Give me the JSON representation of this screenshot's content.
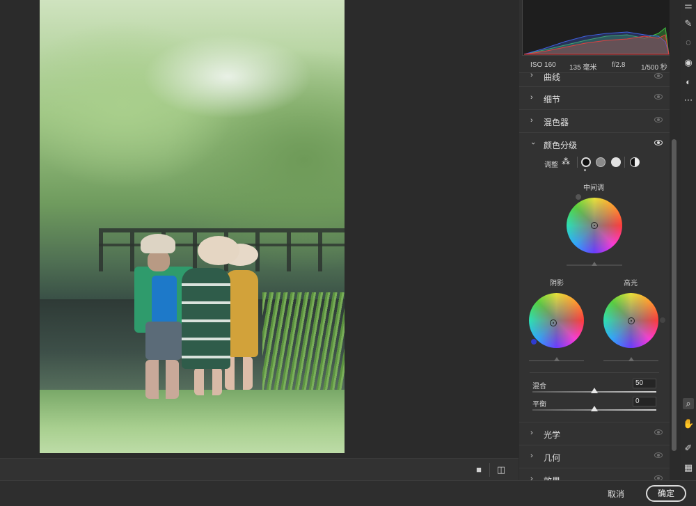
{
  "meta": {
    "iso": "ISO 160",
    "focal": "135 毫米",
    "aperture": "f/2.8",
    "shutter": "1/500 秒"
  },
  "panels": {
    "curves": "曲线",
    "detail": "细节",
    "mixer": "混色器",
    "color_grading": "颜色分级",
    "optics": "光学",
    "geometry": "几何",
    "effects": "效果"
  },
  "grading": {
    "adjust_label": "调整",
    "midtones_label": "中间调",
    "shadows_label": "阴影",
    "highlights_label": "高光",
    "blend_label": "混合",
    "blend_value": "50",
    "balance_label": "平衡",
    "balance_value": "0",
    "blend_fraction": 0.5,
    "balance_fraction": 0.5
  },
  "footer": {
    "cancel": "取消",
    "ok": "确定"
  },
  "colors": {
    "panel_bg": "#303030",
    "canvas_bg": "#2b2b2b",
    "histogram_red": "#e04040",
    "histogram_green": "#40c040",
    "histogram_blue": "#4060e0"
  },
  "icons": {
    "tools": [
      "sliders-icon",
      "healing-brush-icon",
      "masking-icon",
      "redeye-icon",
      "presets-icon",
      "more-icon",
      "zoom-icon",
      "hand-icon",
      "color-sampler-icon",
      "grid-icon"
    ]
  }
}
